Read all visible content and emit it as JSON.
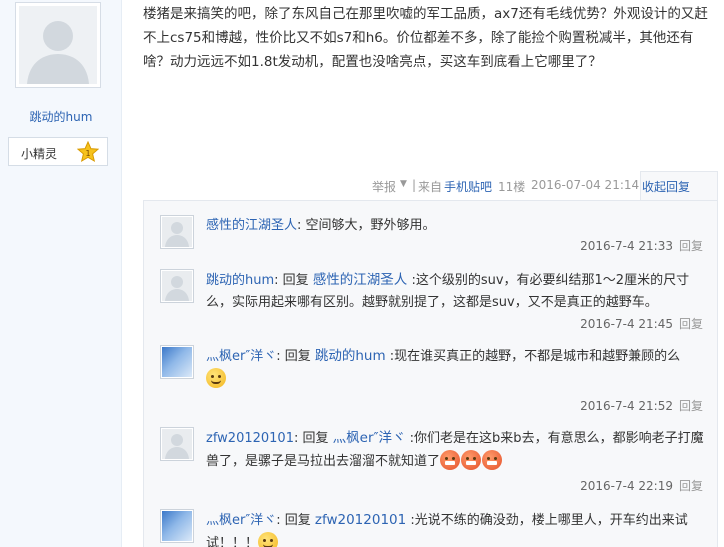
{
  "author": {
    "name": "跳动的hum",
    "level_name": "小精灵",
    "level_num": "1",
    "avatar_icon": "default-avatar-icon"
  },
  "post": {
    "text": "楼猪是来搞笑的吧，除了东风自己在那里吹嘘的军工品质，ax7还有毛线优势？外观设计的又赶不上cs75和博越，性价比又不如s7和h6。价位都差不多，除了能捡个购置税减半，其他还有啥？动力远远不如1.8t发动机，配置也没啥亮点，买这车到底看上它哪里了？"
  },
  "tail": {
    "report": "举报",
    "separator": "|",
    "from": "来自",
    "client": "手机贴吧",
    "floor": "11楼",
    "time": "2016-07-04 21:14",
    "collapse": "收起回复"
  },
  "replies": [
    {
      "author": "感性的江湖圣人",
      "colon": ":",
      "reply_word": "",
      "target": "",
      "content": " 空间够大，野外够用。",
      "time": "2016-7-4 21:33",
      "reply_btn": "回复"
    },
    {
      "author": "跳动的hum",
      "colon": ":",
      "reply_word": " 回复 ",
      "target": "感性的江湖圣人",
      "content": " :这个级别的suv，有必要纠结那1～2厘米的尺寸么，实际用起来哪有区别。越野就别提了，这都是suv，又不是真正的越野车。",
      "time": "2016-7-4 21:45",
      "reply_btn": "回复"
    },
    {
      "author": "灬枫er″洋ヾ",
      "colon": ":",
      "reply_word": " 回复 ",
      "target": "跳动的hum",
      "content": " :现在谁买真正的越野，不都是城市和越野兼顾的么",
      "time": "2016-7-4 21:52",
      "reply_btn": "回复"
    },
    {
      "author": "zfw20120101",
      "colon": ":",
      "reply_word": " 回复 ",
      "target": "灬枫er″洋ヾ",
      "content": " :你们老是在这b来b去，有意思么，都影响老子打魔兽了，是骡子是马拉出去溜溜不就知道了",
      "time": "2016-7-4 22:19",
      "reply_btn": "回复"
    },
    {
      "author": "灬枫er″洋ヾ",
      "colon": ":",
      "reply_word": " 回复 ",
      "target": "zfw20120101",
      "content": " :光说不练的确没劲，楼上哪里人，开车约出来试试！！！",
      "time": "",
      "reply_btn": ""
    }
  ]
}
